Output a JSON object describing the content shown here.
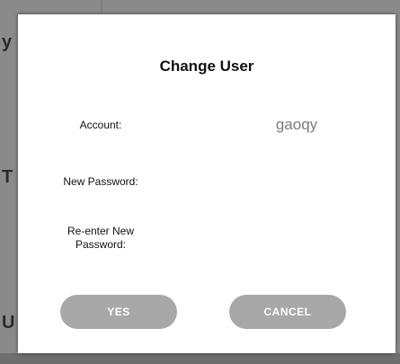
{
  "background": {
    "fragments": [
      "y",
      "T",
      "U"
    ]
  },
  "dialog": {
    "title": "Change User",
    "account_label": "Account:",
    "account_value": "gaoqy",
    "new_password_label": "New Password:",
    "reenter_password_label": "Re-enter New\nPassword:",
    "new_password_value": "",
    "reenter_password_value": "",
    "yes_label": "YES",
    "cancel_label": "CANCEL"
  },
  "colors": {
    "button": "#a8a8a8",
    "value_text": "#7b7b7b",
    "dimmed_background": "#8a8a8a"
  }
}
